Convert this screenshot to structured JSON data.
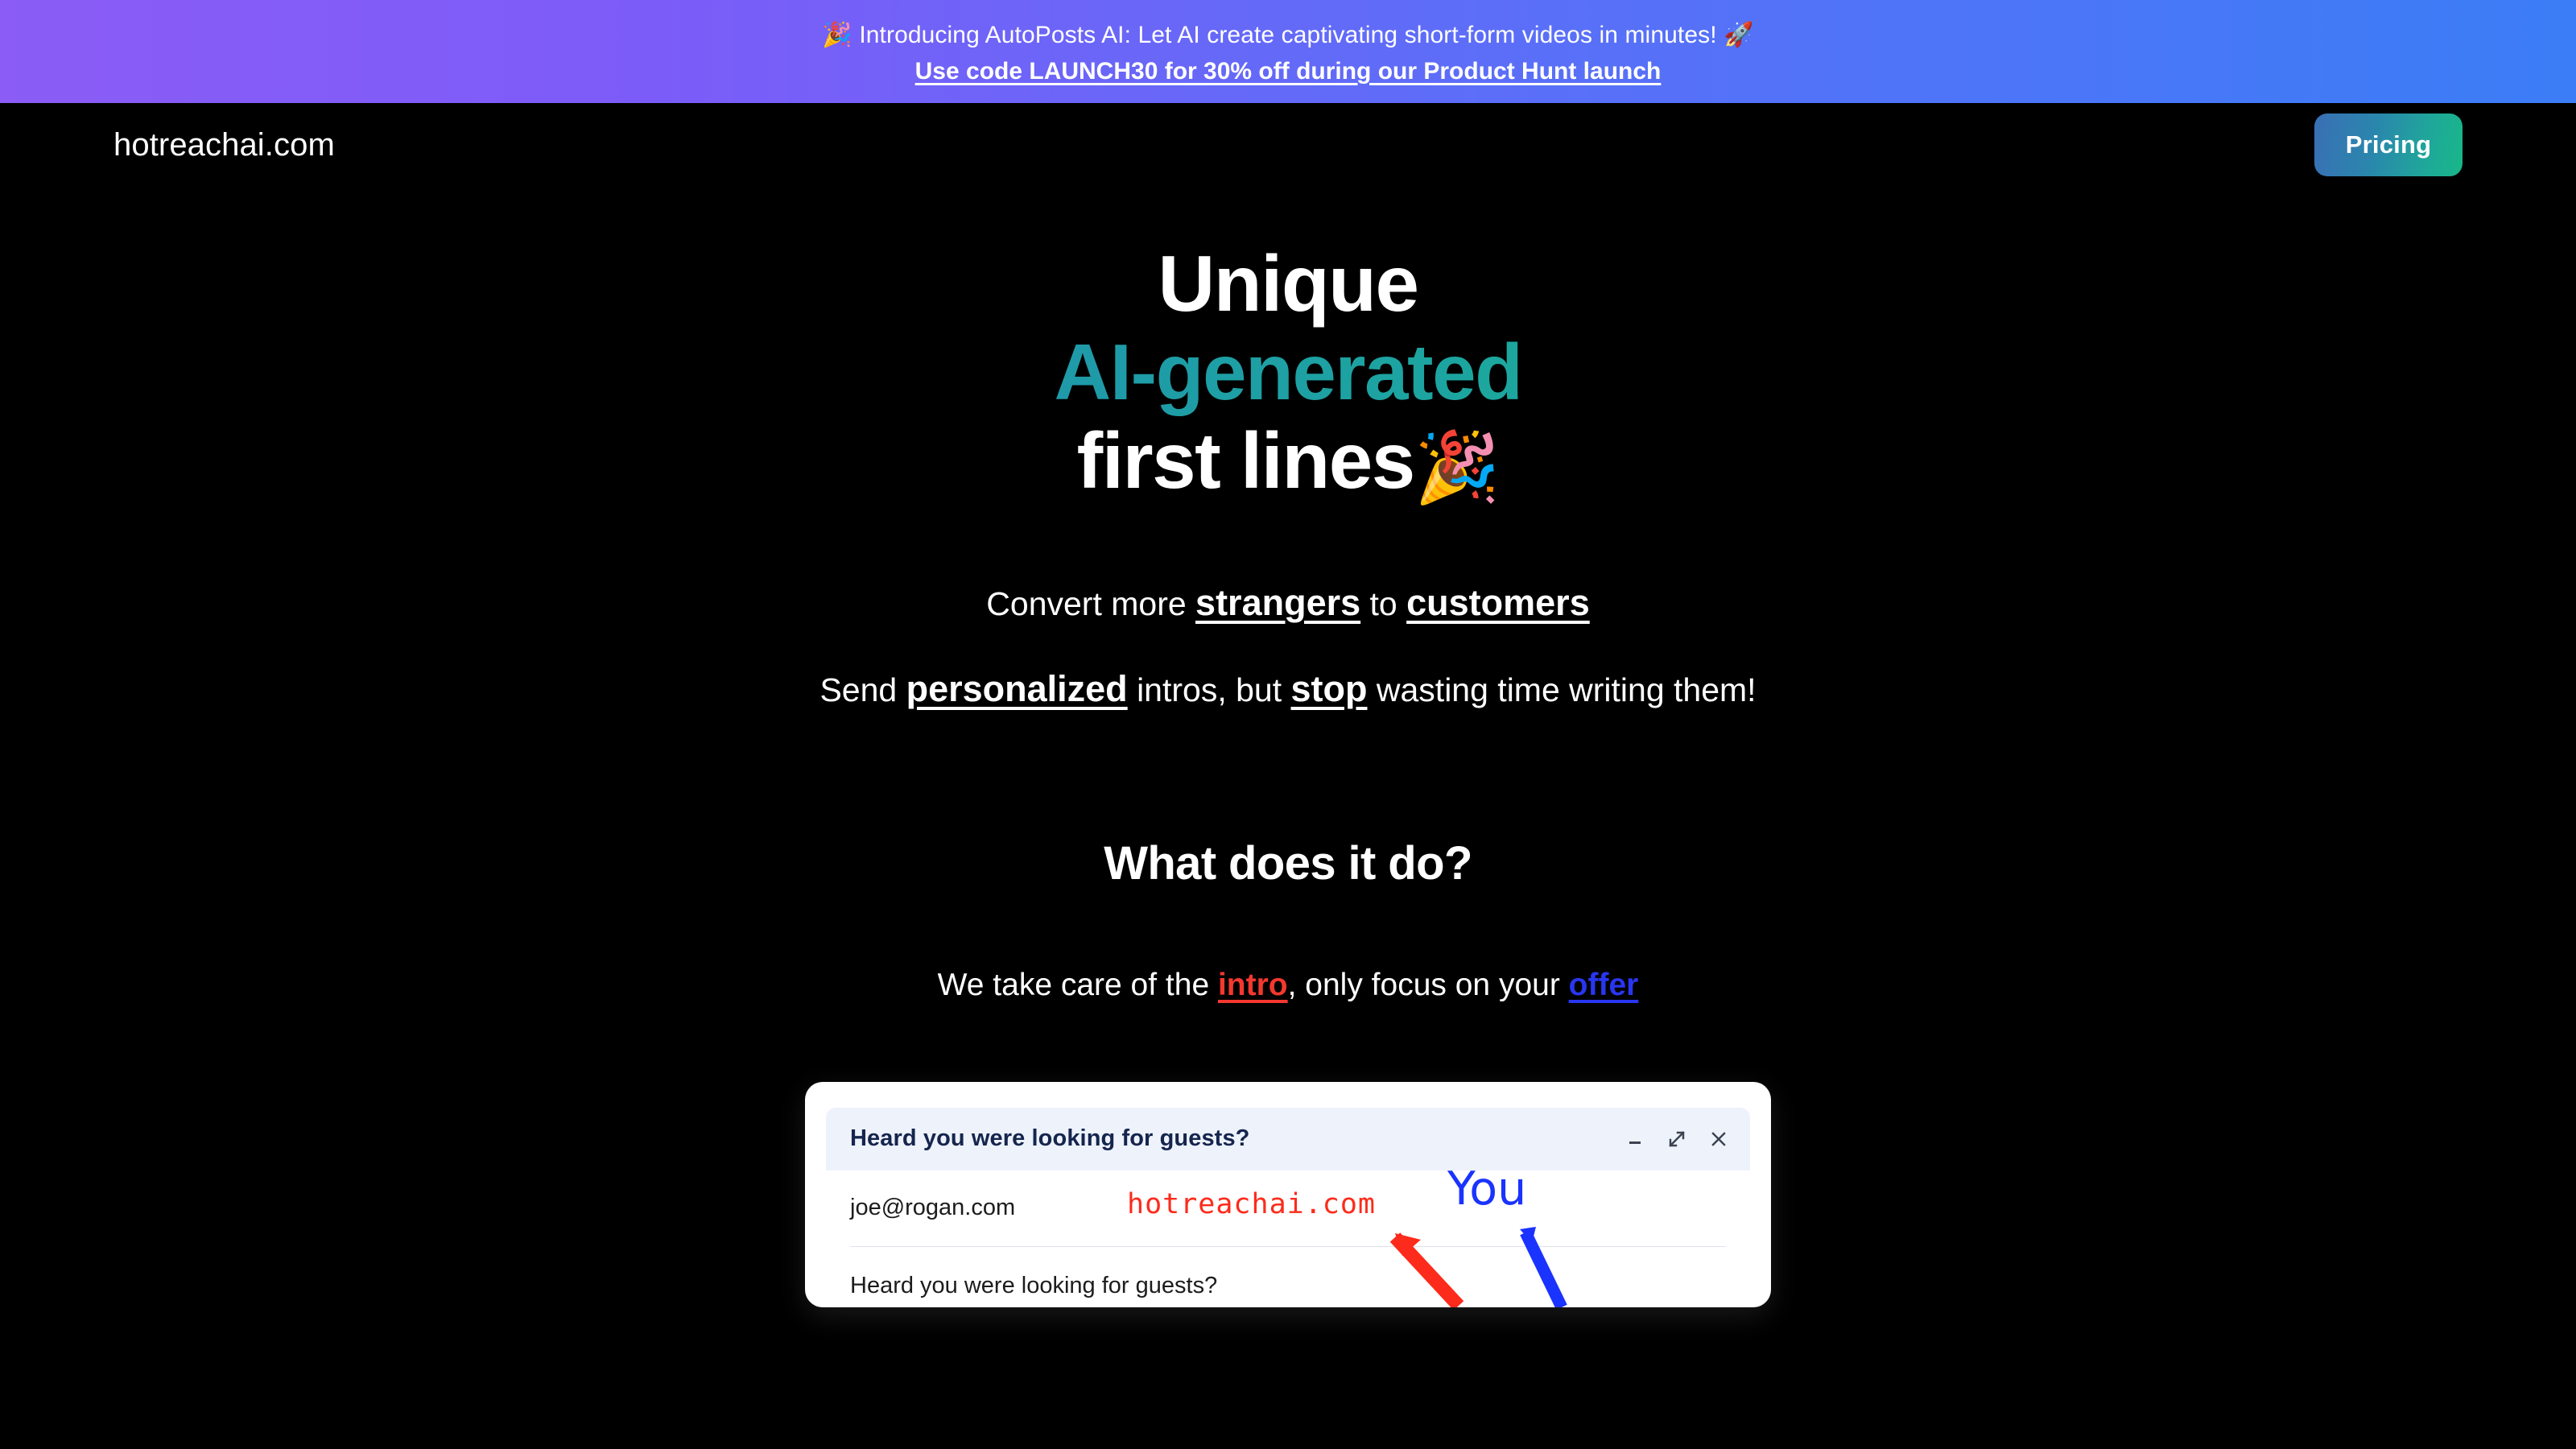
{
  "promo": {
    "line1_emoji_left": "🎉",
    "line1": "Introducing AutoPosts AI: Let AI create captivating short-form videos in minutes!",
    "line1_emoji_right": "🚀",
    "line2": "Use code LAUNCH30 for 30% off during our Product Hunt launch",
    "gradient_from": "#8b5cf6",
    "gradient_to": "#3b7df6"
  },
  "header": {
    "brand": "hotreachai.com",
    "pricing_label": "Pricing",
    "pricing_gradient_from": "#3a6fb5",
    "pricing_gradient_to": "#18b888"
  },
  "hero": {
    "line1": "Unique",
    "line2": "AI-generated",
    "line3": "first lines",
    "line3_emoji": "🎉",
    "gradient_from": "#2d7bb8",
    "gradient_to": "#26b392",
    "sub1_a": "Convert more ",
    "sub1_b": "strangers",
    "sub1_c": " to ",
    "sub1_d": "customers",
    "sub2_a": "Send ",
    "sub2_b": "personalized",
    "sub2_c": " intros, but ",
    "sub2_d": "stop",
    "sub2_e": " wasting time writing them!"
  },
  "what_section": {
    "heading": "What does it do?",
    "tagline_a": "We take care of the ",
    "tagline_intro": "intro",
    "tagline_b": ", only focus on your ",
    "tagline_offer": "offer",
    "intro_color": "#f4382f",
    "offer_color": "#2936f0"
  },
  "mockup": {
    "titlebar_subject": "Heard you were looking for guests?",
    "minimize_icon": "minimize-icon",
    "expand_icon": "expand-icon",
    "close_icon": "close-icon",
    "from_address": "joe@rogan.com",
    "body_subject": "Heard you were looking for guests?",
    "annotation_red": "hotreachai.com",
    "annotation_blue": "You",
    "annotation_red_color": "#fd2b1b",
    "annotation_blue_color": "#1a33ff"
  }
}
